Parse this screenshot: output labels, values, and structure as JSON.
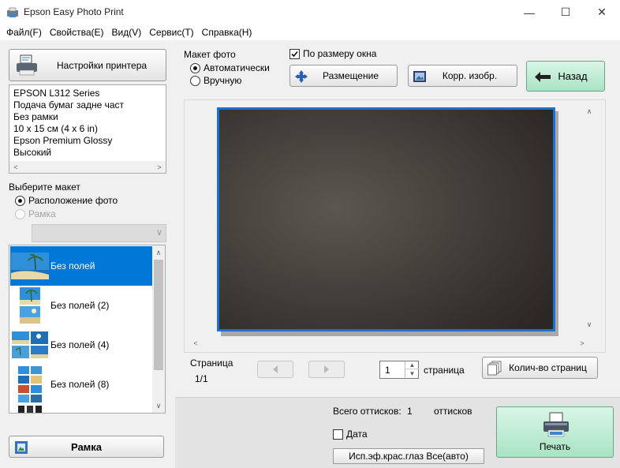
{
  "window": {
    "title": "Epson Easy Photo Print",
    "minimize": "—",
    "maximize": "☐",
    "close": "✕"
  },
  "menu": [
    "Файл(F)",
    "Свойства(E)",
    "Вид(V)",
    "Сервис(T)",
    "Справка(H)"
  ],
  "left": {
    "printer_settings_button": "Настройки принтера",
    "printer_info": [
      "EPSON L312 Series",
      "Подача бумаг задне част",
      "Без рамки",
      "10 x 15 см (4 x 6 in)",
      "Epson Premium Glossy",
      "Высокий"
    ],
    "choose_layout_label": "Выберите макет",
    "layout_modes": [
      {
        "label": "Расположение фото",
        "selected": true,
        "enabled": true
      },
      {
        "label": "Рамка",
        "selected": false,
        "enabled": false
      }
    ],
    "frame_select_value": "",
    "layouts": [
      {
        "label": "Без полей",
        "selected": true
      },
      {
        "label": "Без полей (2)",
        "selected": false
      },
      {
        "label": "Без полей (4)",
        "selected": false
      },
      {
        "label": "Без полей (8)",
        "selected": false
      }
    ],
    "frame_button": "Рамка"
  },
  "top": {
    "photo_layout_label": "Макет фото",
    "layout_options": [
      {
        "label": "Автоматически",
        "selected": true
      },
      {
        "label": "Вручную",
        "selected": false
      }
    ],
    "fit_window_label": "По размеру окна",
    "fit_window_checked": true,
    "placement_button": "Размещение",
    "correct_button": "Корр. изобр.",
    "back_button": "Назад"
  },
  "preview": {
    "page_label": "Страница",
    "page_value": "1/1",
    "page_spin_value": "1",
    "page_suffix": "страница",
    "page_count_button": "Колич-во страниц"
  },
  "bottom": {
    "total_prints_label": "Всего оттисков:",
    "total_prints_value": "1",
    "prints_unit": "оттисков",
    "date_label": "Дата",
    "date_checked": false,
    "red_eye_button": "Исп.эф.крас.глаз Все(авто)",
    "print_button": "Печать"
  },
  "colors": {
    "selection": "#0078d7",
    "green_button": "#b8ead0",
    "photo_border": "#1f6fd0"
  }
}
